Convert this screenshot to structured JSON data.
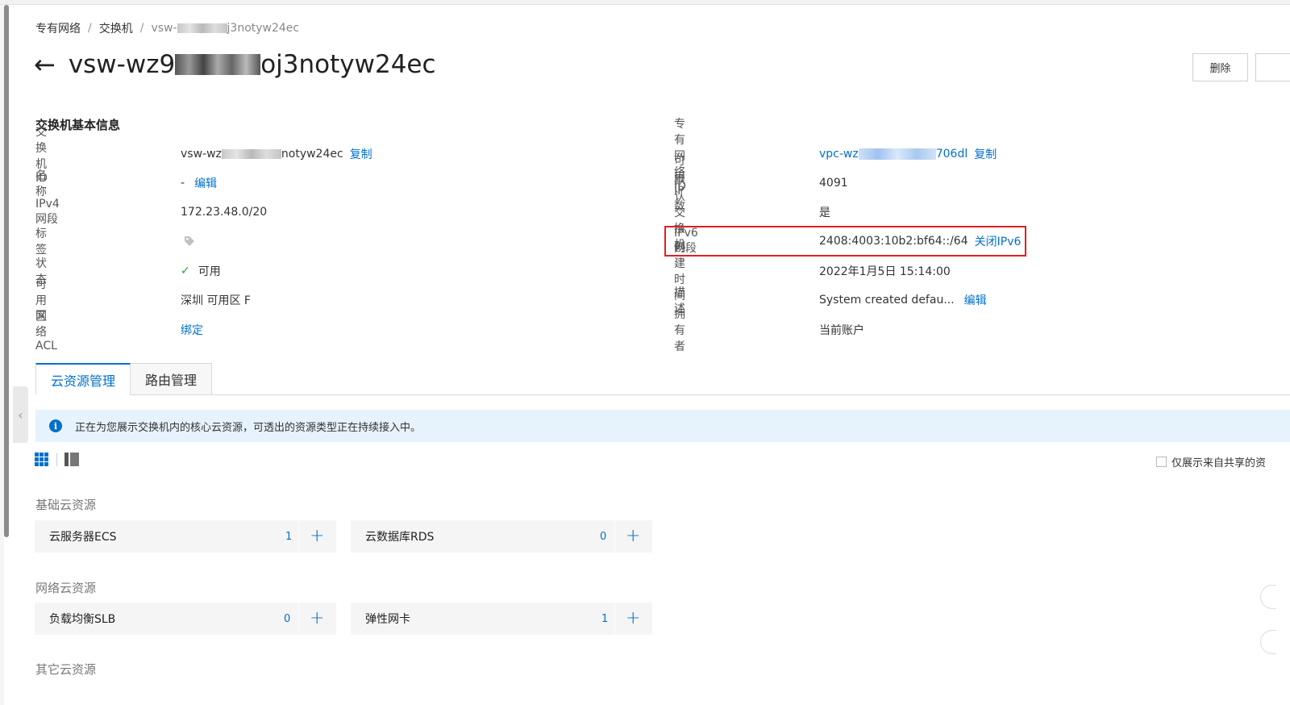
{
  "breadcrumb": {
    "item1": "专有网络",
    "sep": "/",
    "item2": "交换机",
    "item3_prefix": "vsw-",
    "item3_suffix": "j3notyw24ec"
  },
  "header": {
    "title_prefix": "vsw-wz9",
    "title_suffix": "oj3notyw24ec",
    "delete_label": "删除"
  },
  "basic_info": {
    "section_title": "交换机基本信息",
    "left": [
      {
        "label": "交换机ID",
        "value_prefix": "vsw-wz",
        "value_suffix": "notyw24ec",
        "action": "复制"
      },
      {
        "label": "名称",
        "value": "-",
        "action": "编辑"
      },
      {
        "label": "IPv4网段",
        "value": "172.23.48.0/20"
      },
      {
        "label": "标签",
        "icon": "tag-icon"
      },
      {
        "label": "状态",
        "value": "可用",
        "icon": "check-icon"
      },
      {
        "label": "可用区",
        "value": "深圳 可用区 F"
      },
      {
        "label": "网络ACL",
        "action": "绑定"
      }
    ],
    "right": [
      {
        "label": "专有网络ID",
        "value_prefix": "vpc-wz",
        "value_suffix": "706dl",
        "action": "复制"
      },
      {
        "label": "可用IP数",
        "value": "4091"
      },
      {
        "label": "默认交换机",
        "value": "是"
      },
      {
        "label": "IPv6网段",
        "value": "2408:4003:10b2:bf64::/64",
        "action": "关闭IPv6"
      },
      {
        "label": "创建时间",
        "value": "2022年1月5日 15:14:00"
      },
      {
        "label": "描述",
        "value": "System created defau...",
        "action": "编辑"
      },
      {
        "label": "拥有者",
        "value": "当前账户"
      }
    ]
  },
  "tabs": [
    "云资源管理",
    "路由管理"
  ],
  "notice": "正在为您展示交换机内的核心云资源，可透出的资源类型正在持续接入中。",
  "share_filter_label": "仅展示来自共享的资",
  "groups": [
    {
      "title": "基础云资源",
      "items": [
        {
          "name": "云服务器ECS",
          "count": "1"
        },
        {
          "name": "云数据库RDS",
          "count": "0"
        }
      ]
    },
    {
      "title": "网络云资源",
      "items": [
        {
          "name": "负载均衡SLB",
          "count": "0"
        },
        {
          "name": "弹性网卡",
          "count": "1"
        }
      ]
    },
    {
      "title": "其它云资源",
      "items": []
    }
  ],
  "colors": {
    "accent": "#0070cc",
    "highlight": "#e02020",
    "success": "#1e9e3a",
    "notice_bg": "#e6f2fc"
  }
}
